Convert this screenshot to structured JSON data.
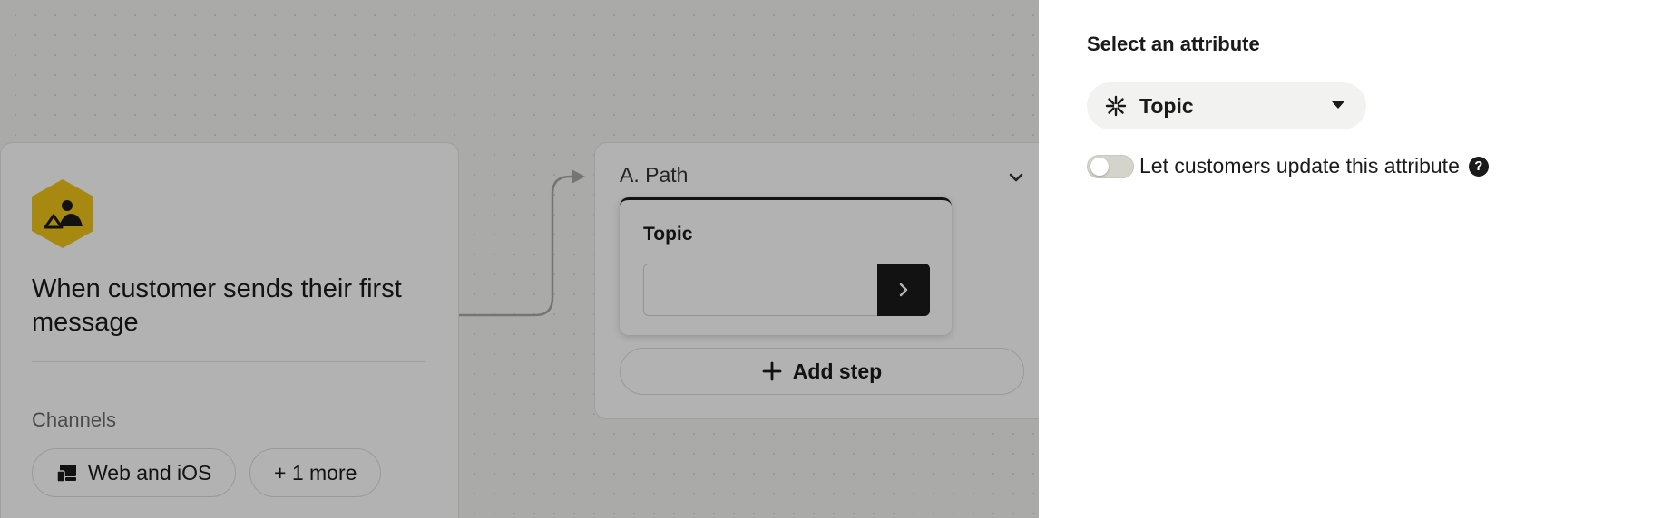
{
  "canvas": {
    "trigger": {
      "title": "When customer sends their first message",
      "channels_label": "Channels",
      "channel_chip": "Web and iOS",
      "more_chip": "+ 1 more",
      "badge_color": "#f0c419"
    },
    "path": {
      "title": "A. Path",
      "step_label": "Topic",
      "step_input_value": "",
      "add_step_label": "Add step"
    }
  },
  "panel": {
    "heading": "Select an attribute",
    "attribute_select": {
      "selected": "Topic"
    },
    "toggle": {
      "label": "Let customers update this attribute",
      "state": "off"
    },
    "help_glyph": "?"
  },
  "icons": [
    "person-mountain-icon",
    "devices-icon",
    "chevron-down-icon",
    "chevron-right-icon",
    "plus-icon",
    "topic-attribute-icon",
    "caret-down-icon",
    "help-icon"
  ]
}
